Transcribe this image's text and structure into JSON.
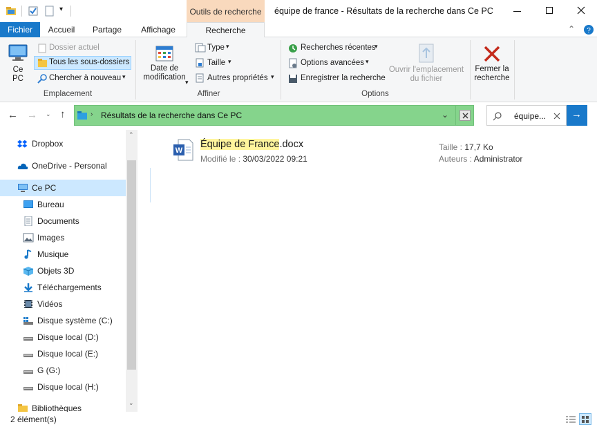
{
  "window": {
    "title": "équipe de france - Résultats de la recherche dans Ce PC",
    "context_tab": "Outils de recherche"
  },
  "ribbon_tabs": [
    "Fichier",
    "Accueil",
    "Partage",
    "Affichage",
    "Recherche"
  ],
  "ribbon": {
    "ce_pc": "Ce\nPC",
    "dossier_actuel": "Dossier actuel",
    "tous_sous_dossiers": "Tous les sous-dossiers",
    "chercher_nouveau": "Chercher à nouveau",
    "group_emplacement": "Emplacement",
    "date_modif": "Date de\nmodification",
    "type": "Type",
    "taille": "Taille",
    "autres_props": "Autres propriétés",
    "group_affiner": "Affiner",
    "recherches_recentes": "Recherches récentes",
    "options_avancees": "Options avancées",
    "enregistrer": "Enregistrer la recherche",
    "ouvrir_emplacement": "Ouvrir l'emplacement\ndu fichier",
    "group_options": "Options",
    "fermer": "Fermer la\nrecherche"
  },
  "address": {
    "path": "Résultats de la recherche dans Ce PC",
    "search_value": "équipe..."
  },
  "nav": {
    "items": [
      {
        "label": "Dropbox",
        "icon": "dropbox-icon",
        "level": 0
      },
      {
        "label": "OneDrive - Personal",
        "icon": "onedrive-icon",
        "level": 0
      },
      {
        "label": "Ce PC",
        "icon": "pc-icon",
        "level": 0,
        "selected": true
      },
      {
        "label": "Bureau",
        "icon": "desktop-icon",
        "level": 1
      },
      {
        "label": "Documents",
        "icon": "documents-icon",
        "level": 1
      },
      {
        "label": "Images",
        "icon": "images-icon",
        "level": 1
      },
      {
        "label": "Musique",
        "icon": "music-icon",
        "level": 1
      },
      {
        "label": "Objets 3D",
        "icon": "objects3d-icon",
        "level": 1
      },
      {
        "label": "Téléchargements",
        "icon": "downloads-icon",
        "level": 1
      },
      {
        "label": "Vidéos",
        "icon": "videos-icon",
        "level": 1
      },
      {
        "label": "Disque système (C:)",
        "icon": "system-drive-icon",
        "level": 1
      },
      {
        "label": "Disque local (D:)",
        "icon": "drive-icon",
        "level": 1
      },
      {
        "label": "Disque local (E:)",
        "icon": "drive-icon",
        "level": 1
      },
      {
        "label": "G (G:)",
        "icon": "drive-icon",
        "level": 1
      },
      {
        "label": "Disque local (H:)",
        "icon": "drive-icon",
        "level": 1
      },
      {
        "label": "Bibliothèques",
        "icon": "libraries-icon",
        "level": 0
      }
    ]
  },
  "result": {
    "name_highlight": "Équipe de France",
    "name_ext": ".docx",
    "modified_label": "Modifié le :",
    "modified_value": "30/03/2022 09:21",
    "size_label": "Taille :",
    "size_value": "17,7 Ko",
    "authors_label": "Auteurs :",
    "authors_value": "Administrator"
  },
  "status": {
    "count": "2 élément(s)"
  },
  "colors": {
    "accent": "#1979ca",
    "context_tab": "#f9d9bd",
    "search_bar_green": "#85d48c",
    "highlight": "#fff59d",
    "close_red": "#c42b1c"
  }
}
